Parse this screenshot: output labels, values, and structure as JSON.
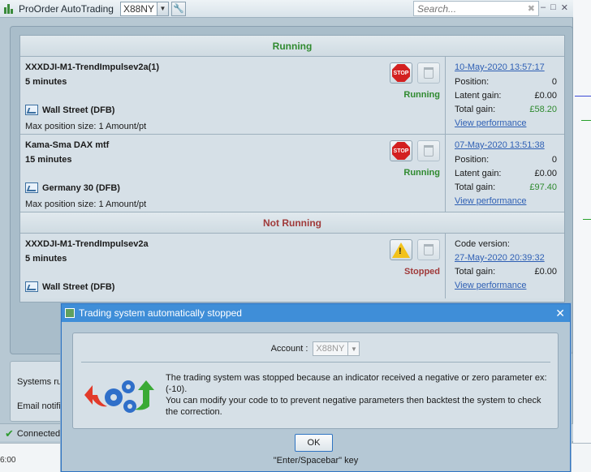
{
  "app": {
    "title": "ProOrder AutoTrading",
    "account": "X88NY",
    "search_placeholder": "Search...",
    "window_controls": [
      "–",
      "□",
      "✕"
    ]
  },
  "sections": {
    "running_header": "Running",
    "not_running_header": "Not Running"
  },
  "systems": [
    {
      "name": "XXXDJI-M1-TrendImpulsev2a(1)",
      "timeframe": "5 minutes",
      "instrument": "Wall Street (DFB)",
      "max_position": "Max position size: 1 Amount/pt",
      "button": "STOP",
      "status": "Running",
      "date": "10-May-2020 13:57:17",
      "position_label": "Position:",
      "position": "0",
      "latent_label": "Latent gain:",
      "latent": "£0.00",
      "total_label": "Total gain:",
      "total": "£58.20",
      "view": "View performance"
    },
    {
      "name": "Kama-Sma DAX mtf",
      "timeframe": "15 minutes",
      "instrument": "Germany 30 (DFB)",
      "max_position": "Max position size: 1 Amount/pt",
      "button": "STOP",
      "status": "Running",
      "date": "07-May-2020 13:51:38",
      "position_label": "Position:",
      "position": "0",
      "latent_label": "Latent gain:",
      "latent": "£0.00",
      "total_label": "Total gain:",
      "total": "£97.40",
      "view": "View performance"
    },
    {
      "name": "XXXDJI-M1-TrendImpulsev2a",
      "timeframe": "5 minutes",
      "instrument": "Wall Street (DFB)",
      "status": "Stopped",
      "code_label": "Code version:",
      "date": "27-May-2020 20:39:32",
      "total_label": "Total gain:",
      "total": "£0.00",
      "view": "View performance"
    }
  ],
  "status_panel": {
    "line1": "Systems ru",
    "line2": "Email notifi"
  },
  "bottom": {
    "connected": "Connected",
    "timeline": "6:00"
  },
  "dialog": {
    "title": "Trading system automatically stopped",
    "account_label": "Account :",
    "account_value": "X88NY",
    "message_line1": "The trading system was stopped because an indicator received a negative or zero parameter ex:(-10).",
    "message_line2": "You can modify your code to to prevent negative parameters then backtest the system to check the correction.",
    "ok": "OK",
    "hint": "\"Enter/Spacebar\" key"
  },
  "colors": {
    "running": "#2f8a2f",
    "stopped": "#a03a3a",
    "link": "#2e5fb4",
    "dialog_title": "#3f8ed8"
  }
}
